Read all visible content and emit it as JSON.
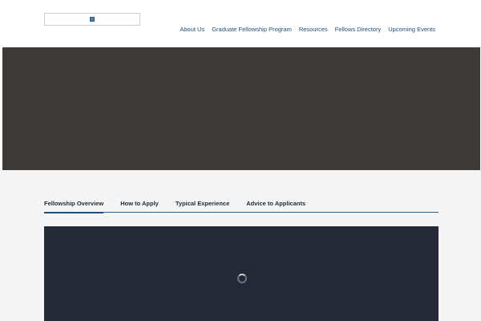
{
  "header": {
    "logo_alt": "",
    "nav": [
      {
        "label": "About Us"
      },
      {
        "label": "Graduate Fellowship Program"
      },
      {
        "label": "Resources"
      },
      {
        "label": "Fellows Directory"
      },
      {
        "label": "Upcoming Events"
      }
    ]
  },
  "hero": {
    "background_color": "#3e3a37"
  },
  "tabs": [
    {
      "label": "Fellowship Overview",
      "active": true
    },
    {
      "label": "How to Apply",
      "active": false
    },
    {
      "label": "Typical Experience",
      "active": false
    },
    {
      "label": "Advice to Applicants",
      "active": false
    }
  ],
  "video": {
    "state": "loading",
    "background_color": "#232a36",
    "icon": "loading-spinner-icon"
  },
  "colors": {
    "accent": "#1f4e79",
    "content_bg": "#f5f5f5"
  }
}
